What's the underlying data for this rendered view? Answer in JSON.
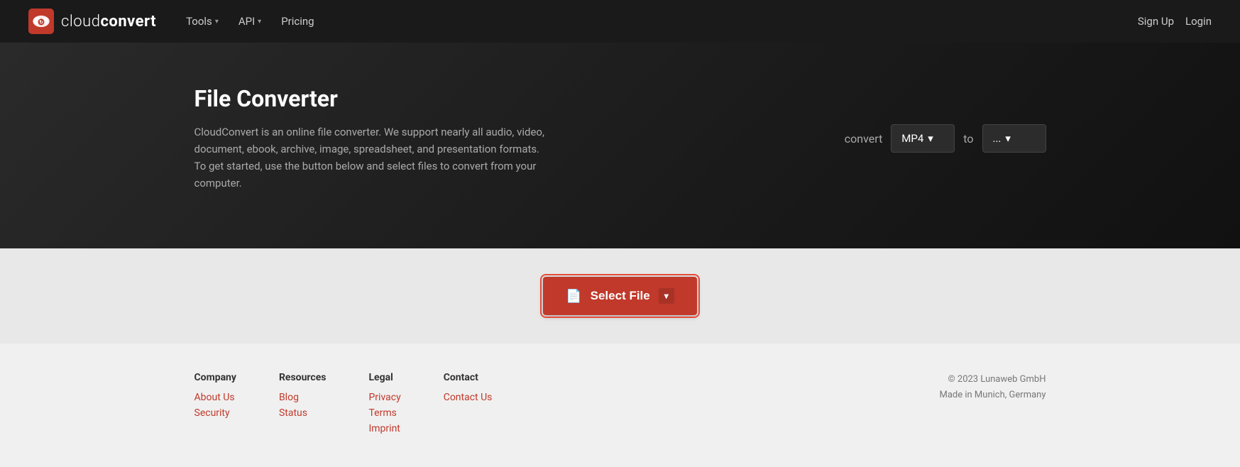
{
  "brand": {
    "name_light": "cloud",
    "name_bold": "convert",
    "logo_alt": "CloudConvert logo"
  },
  "navbar": {
    "tools_label": "Tools",
    "api_label": "API",
    "pricing_label": "Pricing",
    "signup_label": "Sign Up",
    "login_label": "Login"
  },
  "hero": {
    "title": "File Converter",
    "description": "CloudConvert is an online file converter. We support nearly all audio, video, document, ebook, archive, image, spreadsheet, and presentation formats. To get started, use the button below and select files to convert from your computer.",
    "convert_label": "convert",
    "source_format": "MP4",
    "to_label": "to",
    "target_format": "..."
  },
  "cta": {
    "select_file_label": "Select File"
  },
  "footer": {
    "company": {
      "heading": "Company",
      "links": [
        {
          "label": "About Us",
          "url": "#"
        },
        {
          "label": "Security",
          "url": "#"
        }
      ]
    },
    "resources": {
      "heading": "Resources",
      "links": [
        {
          "label": "Blog",
          "url": "#"
        },
        {
          "label": "Status",
          "url": "#"
        }
      ]
    },
    "legal": {
      "heading": "Legal",
      "links": [
        {
          "label": "Privacy",
          "url": "#"
        },
        {
          "label": "Terms",
          "url": "#"
        },
        {
          "label": "Imprint",
          "url": "#"
        }
      ]
    },
    "contact": {
      "heading": "Contact",
      "links": [
        {
          "label": "Contact Us",
          "url": "#"
        }
      ]
    },
    "copyright": "© 2023 Lunaweb GmbH",
    "location": "Made in Munich, Germany"
  }
}
